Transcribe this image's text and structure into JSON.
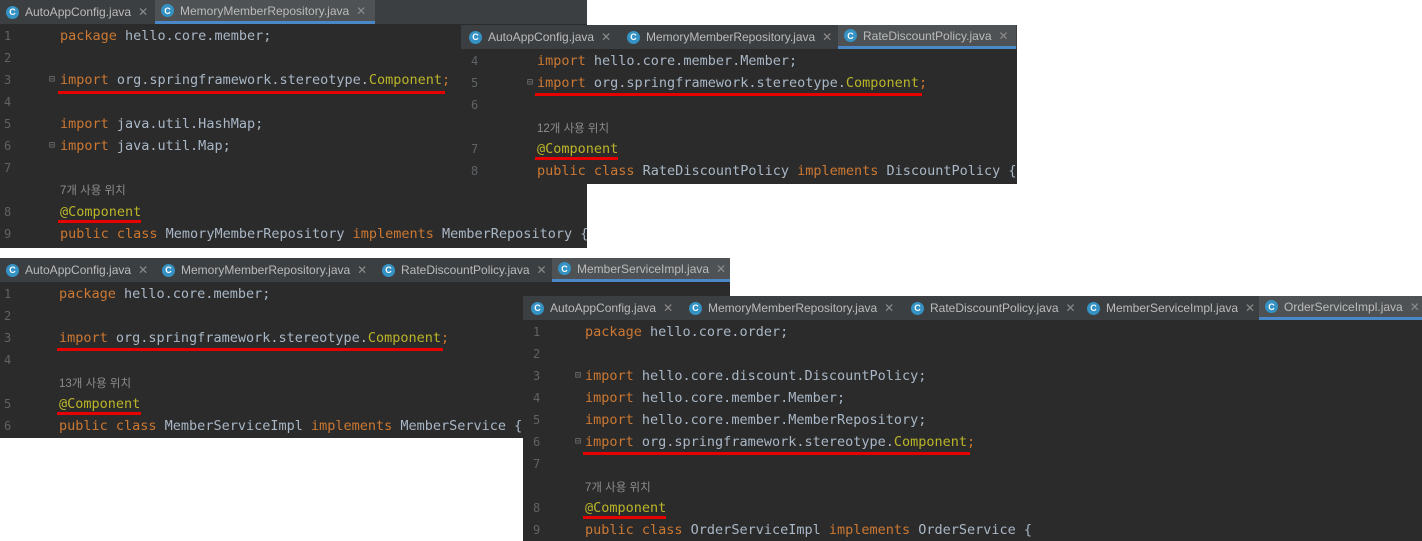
{
  "panel1": {
    "tabs": [
      "AutoAppConfig.java",
      "MemoryMemberRepository.java"
    ],
    "active_tab": 1,
    "line_numbers": [
      "1",
      "2",
      "3",
      "4",
      "5",
      "6",
      "7",
      "8",
      "9"
    ],
    "lines": {
      "l1_kw": "package",
      "l1_rest": " hello.core.member;",
      "l3_kw": "import",
      "l3_mid": " org.springframework.stereotype.",
      "l3_cls": "Component",
      "l3_end": ";",
      "l5_kw": "import",
      "l5_rest": " java.util.HashMap;",
      "l6_kw": "import",
      "l6_rest": " java.util.Map;",
      "hint": "7개 사용 위치",
      "l8_ann": "@Component",
      "l9_kw1": "public class",
      "l9_mid": " MemoryMemberRepository ",
      "l9_kw2": "implements",
      "l9_end": " MemberRepository {"
    }
  },
  "panel2": {
    "tabs": [
      "AutoAppConfig.java",
      "MemoryMemberRepository.java",
      "RateDiscountPolicy.java"
    ],
    "active_tab": 2,
    "line_numbers": [
      "4",
      "5",
      "6",
      "7",
      "8"
    ],
    "lines": {
      "l4_kw": "import",
      "l4_rest": " hello.core.member.Member;",
      "l5_kw": "import",
      "l5_mid": " org.springframework.stereotype.",
      "l5_cls": "Component",
      "l5_end": ";",
      "hint": "12개 사용 위치",
      "l7_ann": "@Component",
      "l8_kw1": "public class",
      "l8_mid": " RateDiscountPolicy ",
      "l8_kw2": "implements",
      "l8_end": " DiscountPolicy {"
    }
  },
  "panel3": {
    "tabs": [
      "AutoAppConfig.java",
      "MemoryMemberRepository.java",
      "RateDiscountPolicy.java",
      "MemberServiceImpl.java"
    ],
    "active_tab": 3,
    "line_numbers": [
      "1",
      "2",
      "3",
      "4",
      "5",
      "6"
    ],
    "lines": {
      "l1_kw": "package",
      "l1_rest": " hello.core.member;",
      "l3_kw": "import",
      "l3_mid": " org.springframework.stereotype.",
      "l3_cls": "Component",
      "l3_end": ";",
      "hint": "13개 사용 위치",
      "l5_ann": "@Component",
      "l6_kw1": "public class",
      "l6_mid": " MemberServiceImpl ",
      "l6_kw2": "implements",
      "l6_end": " MemberService {"
    }
  },
  "panel4": {
    "tabs": [
      "AutoAppConfig.java",
      "MemoryMemberRepository.java",
      "RateDiscountPolicy.java",
      "MemberServiceImpl.java",
      "OrderServiceImpl.java"
    ],
    "active_tab": 4,
    "line_numbers": [
      "1",
      "2",
      "3",
      "4",
      "5",
      "6",
      "7",
      "8",
      "9"
    ],
    "lines": {
      "l1_kw": "package",
      "l1_rest": " hello.core.order;",
      "l3_kw": "import",
      "l3_rest": " hello.core.discount.DiscountPolicy;",
      "l4_kw": "import",
      "l4_rest": " hello.core.member.Member;",
      "l5_kw": "import",
      "l5_rest": " hello.core.member.MemberRepository;",
      "l6_kw": "import",
      "l6_mid": " org.springframework.stereotype.",
      "l6_cls": "Component",
      "l6_end": ";",
      "hint": "7개 사용 위치",
      "l8_ann": "@Component",
      "l9_kw1": "public class",
      "l9_mid": " OrderServiceImpl ",
      "l9_kw2": "implements",
      "l9_end": " OrderService {"
    }
  },
  "colors": {
    "editor_bg": "#2b2b2b",
    "tabbar_bg": "#3c3f41",
    "keyword": "#cc7832",
    "annotation": "#bbb529",
    "text": "#a9b7c6",
    "underline": "#e60000"
  },
  "icons": {
    "tab_icon": "java-class-icon",
    "tab_close": "close-icon"
  }
}
